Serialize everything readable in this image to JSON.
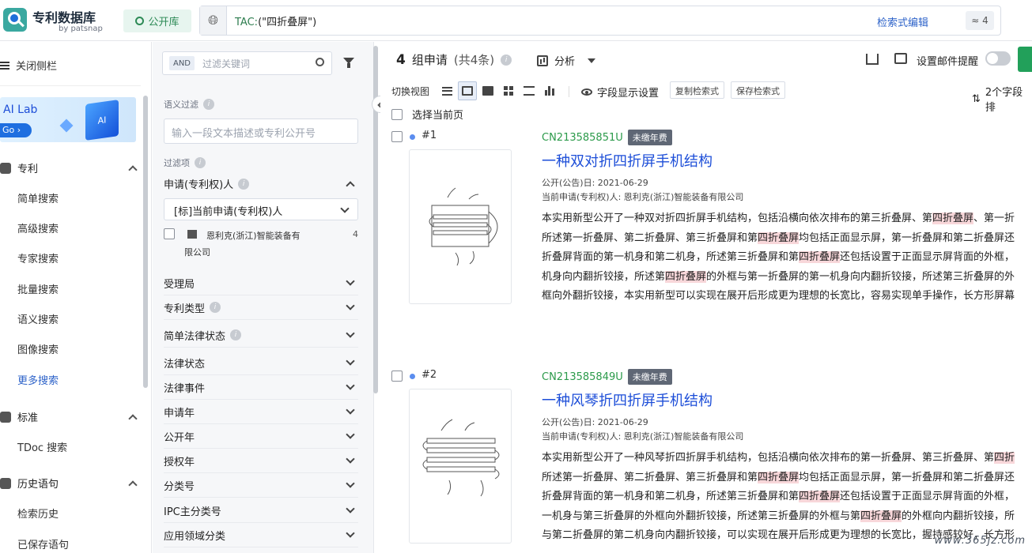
{
  "header": {
    "logo_title": "专利数据库",
    "logo_sub": "by patsnap",
    "library_tag": "公开库",
    "query_prefix": "TAC:",
    "query_value": "(\"四折叠屏\")",
    "edit_link": "检索式编辑",
    "count_badge": "≈ 4"
  },
  "sidebar": {
    "close_label": "关闭侧栏",
    "ailab_title": "AI Lab",
    "ailab_go": "Go",
    "ailab_cube": "AI",
    "sections": [
      {
        "label": "专利",
        "items": [
          "简单搜索",
          "高级搜索",
          "专家搜索",
          "批量搜索",
          "语义搜索",
          "图像搜索",
          "更多搜索"
        ]
      },
      {
        "label": "标准",
        "items": [
          "TDoc 搜索"
        ]
      },
      {
        "label": "历史语句",
        "items": [
          "检索历史",
          "已保存语句"
        ]
      }
    ]
  },
  "filter": {
    "and_tag": "AND",
    "keyword_placeholder": "过滤关键词",
    "semantic_label": "语义过滤",
    "semantic_placeholder": "输入一段文本描述或专利公开号",
    "filter_items_label": "过滤项",
    "applicant_label": "申请(专利权)人",
    "applicant_select": "[标]当前申请(专利权)人",
    "applicant_name_line1": "恩利克(浙江)智能装备有",
    "applicant_name_line2": "限公司",
    "applicant_count": "4",
    "facets": [
      "受理局",
      "专利类型",
      "简单法律状态",
      "法律状态",
      "法律事件",
      "申请年",
      "公开年",
      "授权年",
      "分类号",
      "IPC主分类号",
      "应用领域分类"
    ]
  },
  "results_header": {
    "count": "4",
    "count_label": "组申请",
    "count_sub": "(共4条)",
    "analysis_label": "分析",
    "mail_label": "设置邮件提醒",
    "view_label": "切换视图",
    "field_settings": "字段显示设置",
    "copy_query": "复制检索式",
    "save_query": "保存检索式",
    "sort_label": "2个字段排",
    "select_page": "选择当前页"
  },
  "results": [
    {
      "index": "#1",
      "pub_no": "CN213585851U",
      "status": "未缴年费",
      "title": "一种双对折四折屏手机结构",
      "pub_date": "公开(公告)日:   2021-06-29",
      "applicant": "当前申请(专利权)人:   恩利克(浙江)智能装备有限公司",
      "abstract_lines": [
        [
          "本实用新型公开了一种双对折四折屏手机结构，包括沿横向依次排布的第三折叠屏、第",
          "四折叠屏",
          "、第一折"
        ],
        [
          "所述第一折叠屏、第二折叠屏、第三折叠屏和第",
          "四折叠屏",
          "均包括正面显示屏，第一折叠屏和第二折叠屏还"
        ],
        [
          "折叠屏背面的第一机身和第二机身，所述第三折叠屏和第",
          "四折叠屏",
          "还包括设置于正面显示屏背面的外框，"
        ],
        [
          "机身向内翻折铰接，所述第",
          "四折叠屏",
          "的外框与第一折叠屏的第一机身向内翻折铰接，所述第三折叠屏的外"
        ],
        [
          "框向外翻折铰接，本实用新型可以实现在展开后形成更为理想的长宽比，容易实现单手操作，长方形屏幕",
          "",
          ""
        ]
      ]
    },
    {
      "index": "#2",
      "pub_no": "CN213585849U",
      "status": "未缴年费",
      "title": "一种风琴折四折屏手机结构",
      "pub_date": "公开(公告)日:   2021-06-29",
      "applicant": "当前申请(专利权)人:   恩利克(浙江)智能装备有限公司",
      "abstract_lines": [
        [
          "本实用新型公开了一种风琴折四折屏手机结构，包括沿横向依次排布的第一折叠屏、第三折叠屏、第",
          "四折",
          ""
        ],
        [
          "所述第一折叠屏、第二折叠屏、第三折叠屏和第",
          "四折叠屏",
          "均包括正面显示屏，第一折叠屏和第二折叠屏还"
        ],
        [
          "折叠屏背面的第一机身和第二机身，所述第三折叠屏和第",
          "四折叠屏",
          "还包括设置于正面显示屏背面的外框，"
        ],
        [
          "一机身与第三折叠屏的外框向外翻折铰接，所述第三折叠屏的外框与第",
          "四折叠屏",
          "的外框向内翻折铰接，所"
        ],
        [
          "与第二折叠屏的第二机身向内翻折铰接，可以实现在展开后形成更为理想的长宽比，握持感较好，长方形",
          "",
          ""
        ]
      ]
    }
  ],
  "watermark": "www.365jz.com"
}
